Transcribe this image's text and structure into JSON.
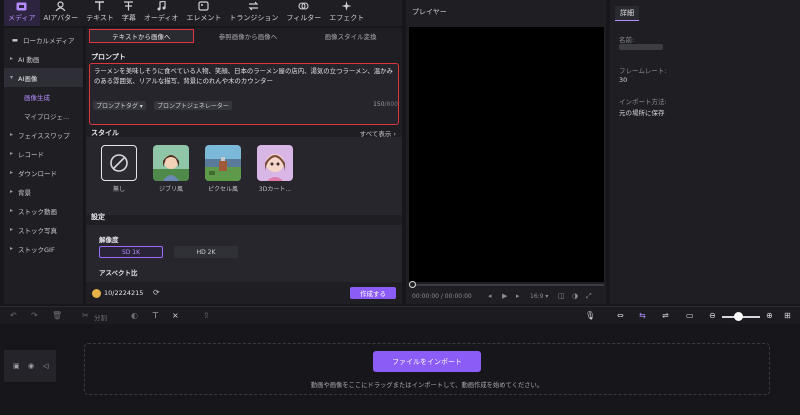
{
  "toolbar": {
    "items": [
      {
        "label": "メディア",
        "icon": "media-folder-icon",
        "active": true
      },
      {
        "label": "AIアバター",
        "icon": "ai-avatar-icon"
      },
      {
        "label": "テキスト",
        "icon": "text-icon"
      },
      {
        "label": "字幕",
        "icon": "subtitle-icon"
      },
      {
        "label": "オーディオ",
        "icon": "music-note-icon"
      },
      {
        "label": "エレメント",
        "icon": "element-icon"
      },
      {
        "label": "トランジション",
        "icon": "transition-icon"
      },
      {
        "label": "フィルター",
        "icon": "filter-icon"
      },
      {
        "label": "エフェクト",
        "icon": "effect-icon"
      }
    ],
    "accent": "#b48cff"
  },
  "sidebar": {
    "items": [
      {
        "label": "ローカルメディア"
      },
      {
        "label": "AI 動画"
      },
      {
        "label": "AI画像"
      },
      {
        "label": "画像生成"
      },
      {
        "label": "マイプロジェ..."
      },
      {
        "label": "フェイススワップ"
      },
      {
        "label": "レコード"
      },
      {
        "label": "ダウンロード"
      },
      {
        "label": "背景"
      },
      {
        "label": "ストック動画"
      },
      {
        "label": "ストック写真"
      },
      {
        "label": "ストックGIF"
      }
    ]
  },
  "center": {
    "tabs": [
      "テキストから画像へ",
      "参照画像から画像へ",
      "画像スタイル変換"
    ],
    "prompt_title": "プロンプト",
    "prompt_text": "ラーメンを美味しそうに食べている人物、笑顔、日本のラーメン屋の店内、湯気の立つラーメン、温かみのある雰囲気、リアルな描写、背景にのれんや木のカウンター",
    "prompt_tag": "プロンプトタグ ▾",
    "prompt_generator": "プロンプトジェネレーター",
    "char_count": "150",
    "char_max": "/800",
    "style_title": "スタイル",
    "show_all": "すべて表示 ›",
    "styles": [
      {
        "label": "無し"
      },
      {
        "label": "ジブリ風"
      },
      {
        "label": "ピクセル風"
      },
      {
        "label": "3Dカート..."
      }
    ],
    "settings_title": "設定",
    "resolution_title": "解像度",
    "res_sd": "SD 1K",
    "res_hd": "HD 2K",
    "aspect_title": "アスペクト比",
    "credits_used": "10",
    "credits_total": "/2224215",
    "generate_button": "作成する",
    "highlight_color": "#e0353f",
    "button_color": "#8b5cf6"
  },
  "player": {
    "title": "プレイヤー",
    "time": "00:00:00 / 00:00:00",
    "ratio": "16:9 ▾"
  },
  "details": {
    "tab": "詳細",
    "name_label": "名前:",
    "framerate_label": "フレームレート:",
    "framerate_value": "30",
    "import_label": "インポート方法:",
    "import_value": "元の場所に保存"
  },
  "timeline": {
    "split_label": "分割",
    "import_button": "ファイルをインポート",
    "drop_hint": "動画や画像をここにドラッグまたはインポートして、動画作成を始めてください。"
  }
}
